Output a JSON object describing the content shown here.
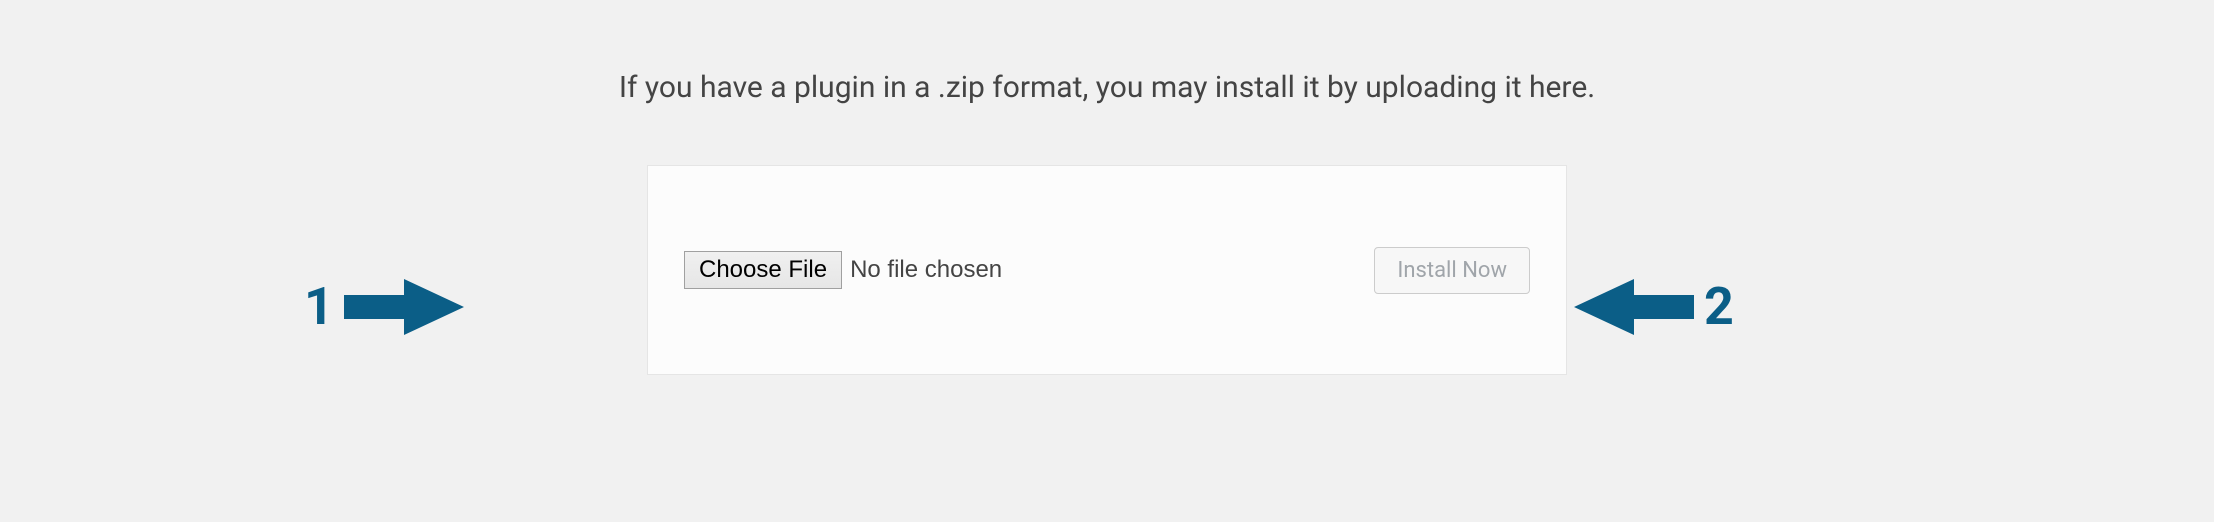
{
  "intro": "If you have a plugin in a .zip format, you may install it by uploading it here.",
  "upload": {
    "choose_label": "Choose File",
    "status": "No file chosen",
    "install_label": "Install Now"
  },
  "annotations": {
    "step1": "1",
    "step2": "2",
    "arrow_color": "#0b5e87"
  }
}
